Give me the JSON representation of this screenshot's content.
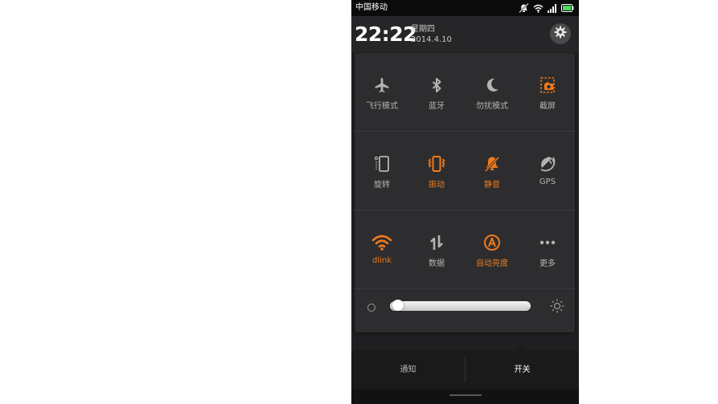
{
  "status_bar": {
    "carrier": "中国移动"
  },
  "clock": {
    "time": "22:22",
    "weekday": "星期四",
    "date": "2014.4.10"
  },
  "colors": {
    "accent": "#f07a1a",
    "inactive": "#b4b4b4",
    "panel": "#2d2d2f"
  },
  "toggles": {
    "airplane": {
      "label": "飞行模式",
      "icon": "airplane-icon",
      "on": false
    },
    "bluetooth": {
      "label": "蓝牙",
      "icon": "bluetooth-icon",
      "on": false
    },
    "dnd": {
      "label": "勿扰模式",
      "icon": "moon-icon",
      "on": false
    },
    "screenshot": {
      "label": "截屏",
      "icon": "screenshot-icon",
      "on": true
    },
    "rotate": {
      "label": "旋转",
      "icon": "rotate-icon",
      "on": false
    },
    "vibrate": {
      "label": "振动",
      "icon": "vibrate-icon",
      "on": true
    },
    "silent": {
      "label": "静音",
      "icon": "mute-bell-icon",
      "on": true
    },
    "gps": {
      "label": "GPS",
      "icon": "gps-icon",
      "on": false
    },
    "wifi": {
      "label": "dlink",
      "icon": "wifi-icon",
      "on": true
    },
    "data": {
      "label": "数据",
      "icon": "data-arrows-icon",
      "on": false
    },
    "auto_brightness": {
      "label": "自动亮度",
      "icon": "auto-brightness-icon",
      "on": true
    },
    "more": {
      "label": "更多",
      "icon": "more-dots-icon",
      "on": false
    }
  },
  "brightness": {
    "level": 0.03
  },
  "tabs": {
    "notify": "通知",
    "switches": "开关",
    "active": "switches"
  }
}
